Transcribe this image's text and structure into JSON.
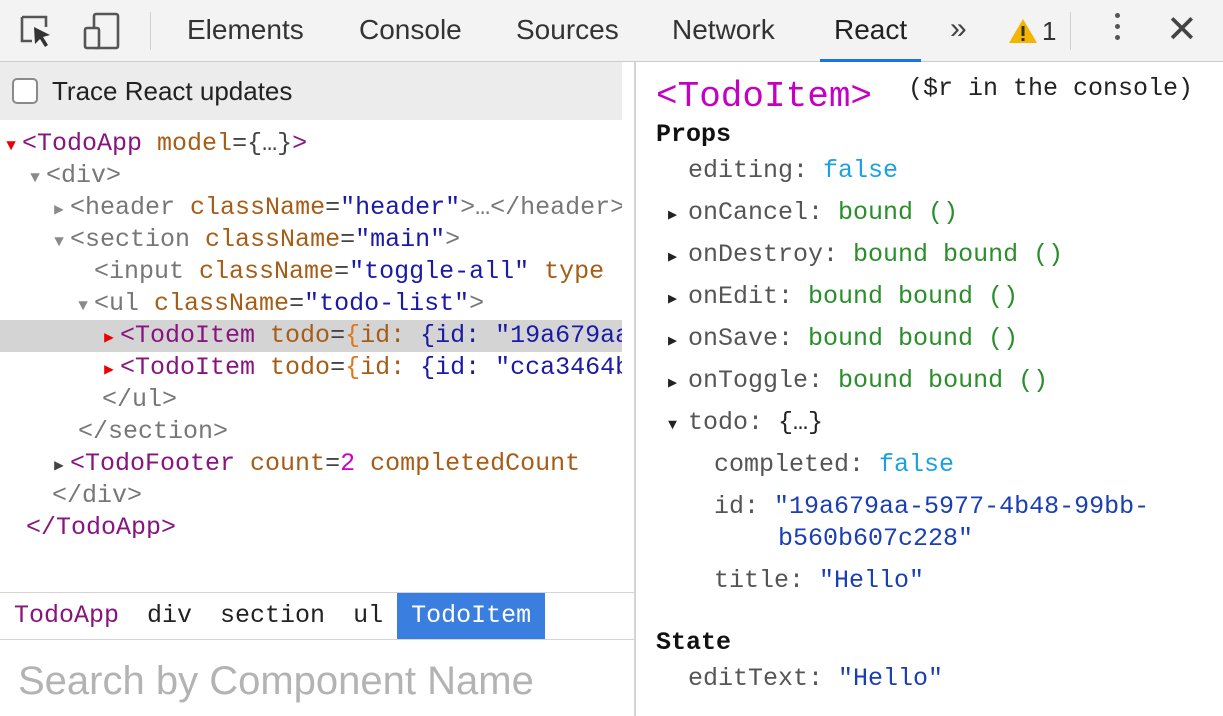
{
  "toolbar": {
    "tabs": [
      "Elements",
      "Console",
      "Sources",
      "Network",
      "React"
    ],
    "active_tab": "React",
    "overflow": "»",
    "warning_count": "1",
    "close": "✕"
  },
  "left": {
    "trace_label": "Trace React updates",
    "tree": [
      {
        "t": "<TodoApp",
        "a1": "model",
        "v1": "{…}",
        "e": ">"
      },
      {
        "t": "<div>"
      },
      {
        "t": "<header",
        "a1": "className",
        "v1": "\"header\"",
        "e": ">…</header>"
      },
      {
        "t": "<section",
        "a1": "className",
        "v1": "\"main\"",
        "e": ">"
      },
      {
        "t": "<input",
        "a1": "className",
        "v1": "\"toggle-all\"",
        "a2": "type"
      },
      {
        "t": "<ul",
        "a1": "className",
        "v1": "\"todo-list\"",
        "e": ">"
      },
      {
        "t": "<TodoItem",
        "a1": "todo",
        "v1": "{id: \"19a679aa-5977-4b48-99bb-b560b607c228\"",
        "e": "…}>"
      },
      {
        "t": "<TodoItem",
        "a1": "todo",
        "v1": "{id: \"cca3464b-8f1c\"",
        "e": "…}>"
      },
      {
        "t": "</ul>"
      },
      {
        "t": "</section>"
      },
      {
        "t": "<TodoFooter",
        "a1": "count",
        "v1": "2",
        "a2": "completedCount"
      },
      {
        "t": "</div>"
      },
      {
        "t": "</TodoApp>"
      }
    ],
    "breadcrumbs": [
      "TodoApp",
      "div",
      "section",
      "ul",
      "TodoItem"
    ],
    "search_placeholder": "Search by Component Name"
  },
  "right": {
    "component": "<TodoItem>",
    "hint": "($r in the console)",
    "props_heading": "Props",
    "state_heading": "State",
    "props": {
      "editing_key": "editing",
      "editing_val": "false",
      "oncancel_key": "onCancel",
      "oncancel_val": "bound ()",
      "ondestroy_key": "onDestroy",
      "ondestroy_val": "bound bound ()",
      "onedit_key": "onEdit",
      "onedit_val": "bound bound ()",
      "onsave_key": "onSave",
      "onsave_val": "bound bound ()",
      "ontoggle_key": "onToggle",
      "ontoggle_val": "bound bound ()",
      "todo_key": "todo",
      "todo_val": "{…}",
      "completed_key": "completed",
      "completed_val": "false",
      "id_key": "id",
      "id_val_1": "\"19a679aa-5977-4b48-99bb-",
      "id_val_2": "b560b607c228\"",
      "title_key": "title",
      "title_val": "\"Hello\""
    },
    "state": {
      "edittext_key": "editText",
      "edittext_val": "\"Hello\""
    }
  }
}
